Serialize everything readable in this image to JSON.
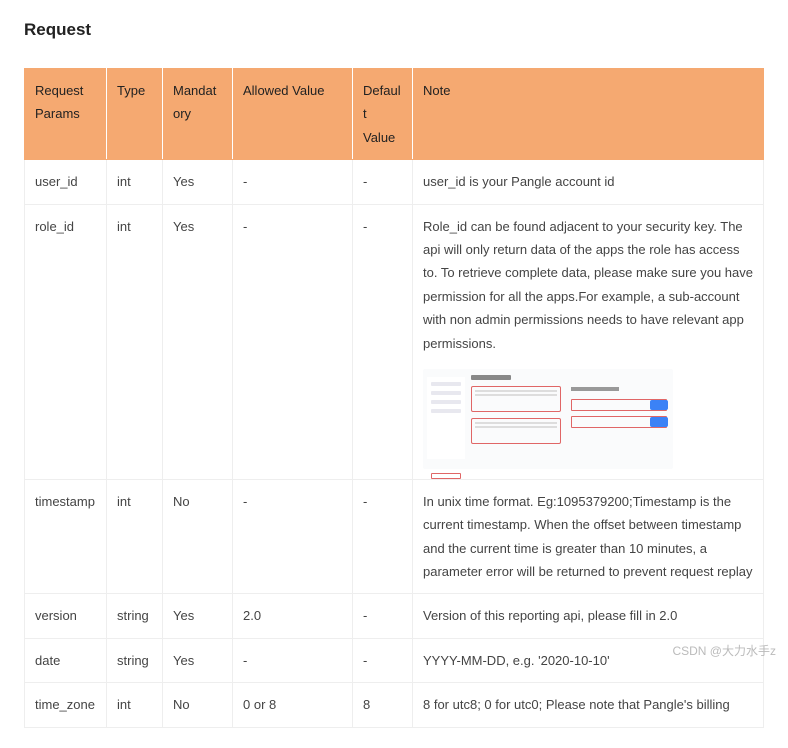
{
  "title": "Request",
  "headers": {
    "params": "Request Params",
    "type": "Type",
    "mandatory": "Mandatory",
    "allowed": "Allowed Value",
    "default": "Default Value",
    "note": "Note"
  },
  "rows": [
    {
      "param": "user_id",
      "type": "int",
      "mandatory": "Yes",
      "allowed": "-",
      "default": "-",
      "note": "user_id is your Pangle account id"
    },
    {
      "param": "role_id",
      "type": "int",
      "mandatory": "Yes",
      "allowed": "-",
      "default": "-",
      "note": "Role_id can be found adjacent to your security key. The api will only return data of the apps the role has access to. To retrieve complete data, please make sure you have permission for all the apps.For example, a sub-account with non admin permissions needs to have relevant app permissions."
    },
    {
      "param": "timestamp",
      "type": "int",
      "mandatory": "No",
      "allowed": "-",
      "default": "-",
      "note": "In unix time format. Eg:1095379200;Timestamp is the current timestamp. When the offset between timestamp and the current time is greater than 10 minutes, a parameter error will be returned to prevent request replay"
    },
    {
      "param": "version",
      "type": "string",
      "mandatory": "Yes",
      "allowed": "2.0",
      "default": "-",
      "note": "Version of this reporting api, please fill in 2.0"
    },
    {
      "param": "date",
      "type": "string",
      "mandatory": "Yes",
      "allowed": "-",
      "default": "-",
      "note": "YYYY-MM-DD, e.g. '2020-10-10'"
    },
    {
      "param": "time_zone",
      "type": "int",
      "mandatory": "No",
      "allowed": "0 or 8",
      "default": "8",
      "note": "8 for utc8; 0 for utc0; Please note that Pangle's billing"
    }
  ],
  "watermark": "CSDN @大力水手z"
}
